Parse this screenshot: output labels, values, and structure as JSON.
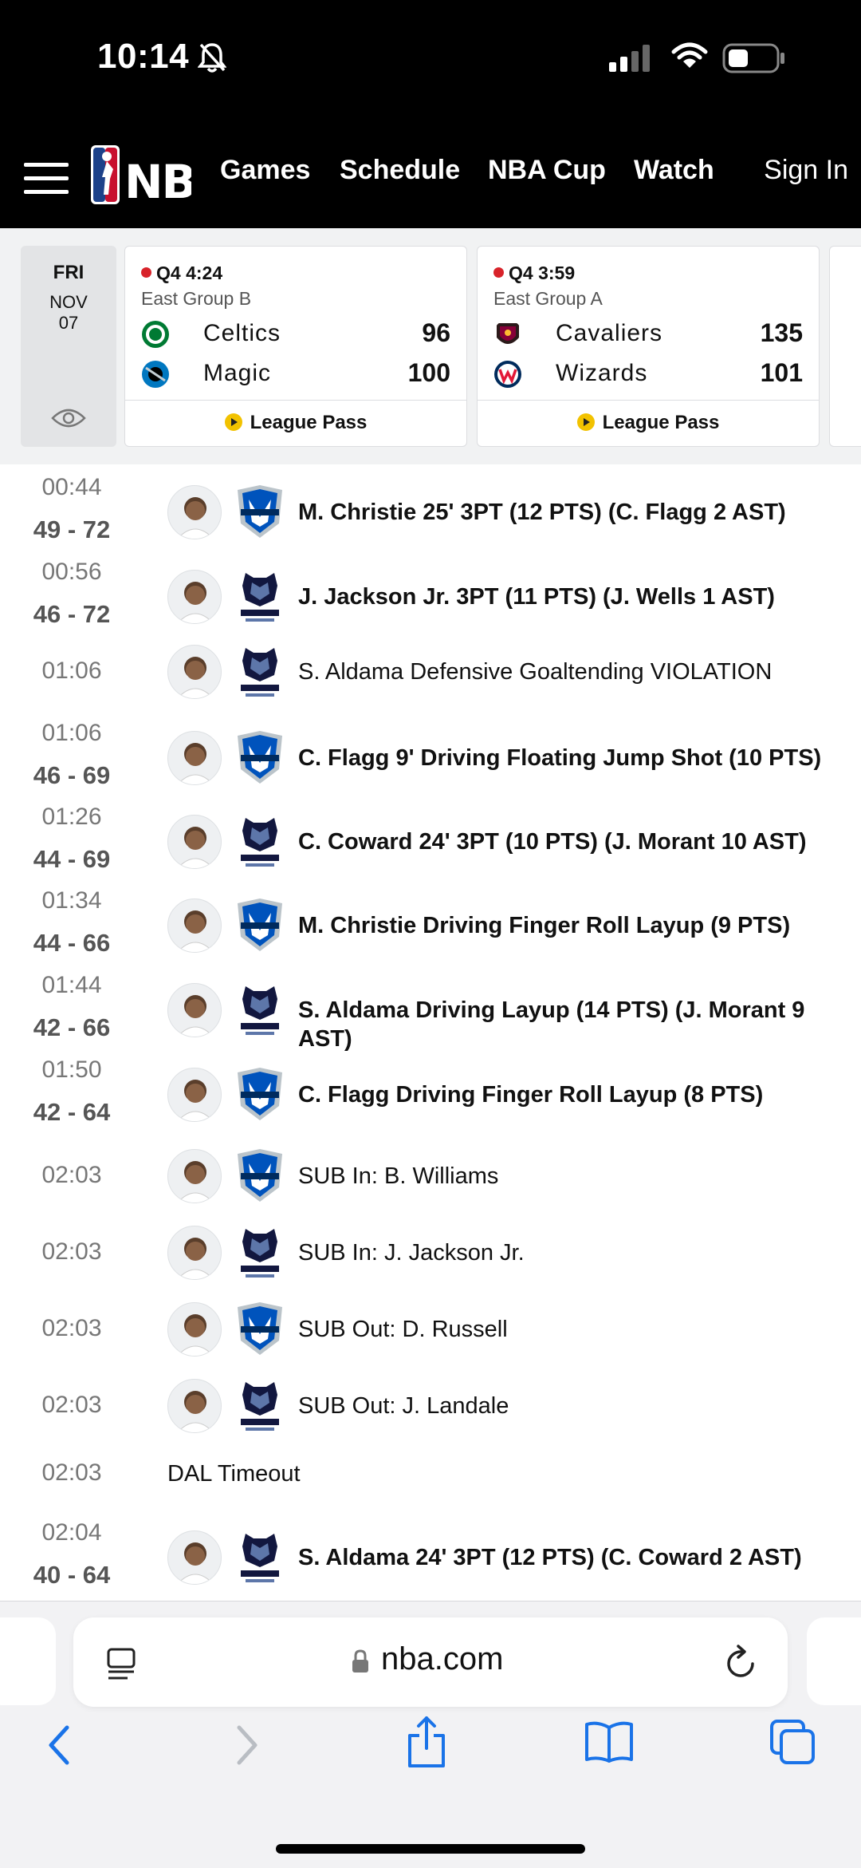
{
  "status_bar": {
    "time": "10:14"
  },
  "nav": {
    "links": [
      "Games",
      "Schedule",
      "NBA Cup",
      "Watch"
    ],
    "sign_in": "Sign In"
  },
  "date": {
    "dow": "FRI",
    "month": "NOV",
    "day": "07"
  },
  "games": [
    {
      "status": "Q4 4:24",
      "group": "East Group B",
      "teams": [
        {
          "name": "Celtics",
          "score": "96",
          "color": "#007a33"
        },
        {
          "name": "Magic",
          "score": "100",
          "color": "#0077c0"
        }
      ],
      "footer": "League Pass"
    },
    {
      "status": "Q4 3:59",
      "group": "East Group A",
      "teams": [
        {
          "name": "Cavaliers",
          "score": "135",
          "color": "#860038"
        },
        {
          "name": "Wizards",
          "score": "101",
          "color": "#002b5c"
        }
      ],
      "footer": "League Pass"
    }
  ],
  "plays": [
    {
      "time": "00:44",
      "score": "49 - 72",
      "team": "dal",
      "desc": "M. Christie 25' 3PT (12 PTS) (C. Flagg 2 AST)",
      "bold": true
    },
    {
      "time": "00:56",
      "score": "46 - 72",
      "team": "mem",
      "desc": "J. Jackson Jr. 3PT (11 PTS) (J. Wells 1 AST)",
      "bold": true
    },
    {
      "time": "01:06",
      "score": "",
      "team": "mem",
      "desc": "S. Aldama Defensive Goaltending VIOLATION",
      "bold": false
    },
    {
      "time": "01:06",
      "score": "46 - 69",
      "team": "dal",
      "desc": "C. Flagg 9' Driving Floating Jump Shot (10 PTS)",
      "bold": true
    },
    {
      "time": "01:26",
      "score": "44 - 69",
      "team": "mem",
      "desc": "C. Coward 24' 3PT (10 PTS) (J. Morant 10 AST)",
      "bold": true
    },
    {
      "time": "01:34",
      "score": "44 - 66",
      "team": "dal",
      "desc": "M. Christie Driving Finger Roll Layup (9 PTS)",
      "bold": true
    },
    {
      "time": "01:44",
      "score": "42 - 66",
      "team": "mem",
      "desc": "S. Aldama Driving Layup (14 PTS) (J. Morant 9 AST)",
      "bold": true
    },
    {
      "time": "01:50",
      "score": "42 - 64",
      "team": "dal",
      "desc": "C. Flagg Driving Finger Roll Layup (8 PTS)",
      "bold": true
    },
    {
      "time": "02:03",
      "score": "",
      "team": "dal",
      "desc": "SUB In: B. Williams",
      "bold": false
    },
    {
      "time": "02:03",
      "score": "",
      "team": "mem",
      "desc": "SUB In: J. Jackson Jr.",
      "bold": false
    },
    {
      "time": "02:03",
      "score": "",
      "team": "dal",
      "desc": "SUB Out: D. Russell",
      "bold": false
    },
    {
      "time": "02:03",
      "score": "",
      "team": "mem",
      "desc": "SUB Out: J. Landale",
      "bold": false
    },
    {
      "time": "02:03",
      "score": "",
      "team": "",
      "desc": "DAL Timeout",
      "bold": false
    },
    {
      "time": "02:04",
      "score": "40 - 64",
      "team": "mem",
      "desc": "S. Aldama 24' 3PT (12 PTS) (C. Coward 2 AST)",
      "bold": true
    }
  ],
  "browser": {
    "url": "nba.com"
  },
  "colors": {
    "live_dot": "#d8232a",
    "ios_blue": "#1a73e8",
    "mavs_blue": "#0053bc",
    "grizzlies_navy": "#12173f"
  }
}
